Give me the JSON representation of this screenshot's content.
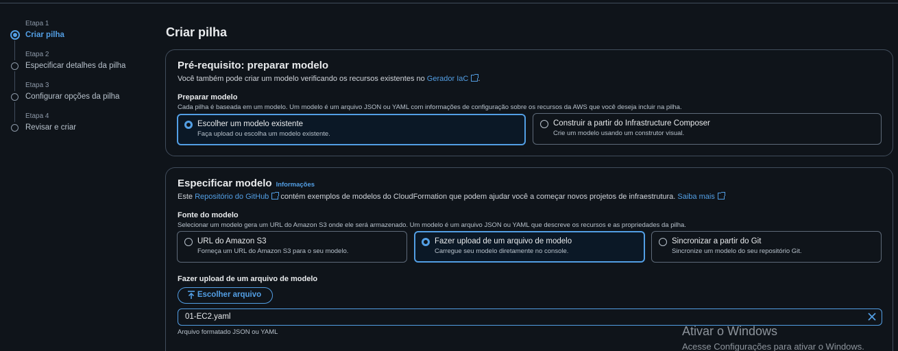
{
  "steps": [
    {
      "number": "Etapa 1",
      "name": "Criar pilha"
    },
    {
      "number": "Etapa 2",
      "name": "Especificar detalhes da pilha"
    },
    {
      "number": "Etapa 3",
      "name": "Configurar opções da pilha"
    },
    {
      "number": "Etapa 4",
      "name": "Revisar e criar"
    }
  ],
  "page_title": "Criar pilha",
  "prereq": {
    "title": "Pré-requisito: preparar modelo",
    "desc_prefix": "Você também pode criar um modelo verificando os recursos existentes no ",
    "desc_link": "Gerador IaC",
    "desc_suffix": ".",
    "field_label": "Preparar modelo",
    "field_help": "Cada pilha é baseada em um modelo. Um modelo é um arquivo JSON ou YAML com informações de configuração sobre os recursos da AWS que você deseja incluir na pilha.",
    "options": [
      {
        "title": "Escolher um modelo existente",
        "sub": "Faça upload ou escolha um modelo existente.",
        "selected": true
      },
      {
        "title": "Construir a partir do Infrastructure Composer",
        "sub": "Crie um modelo usando um construtor visual.",
        "selected": false
      }
    ]
  },
  "spec": {
    "title": "Especificar modelo",
    "info_link": "Informações",
    "desc_prefix": "Este ",
    "desc_link1": "Repositório do GitHub",
    "desc_middle": " contém exemplos de modelos do CloudFormation que podem ajudar você a começar novos projetos de infraestrutura. ",
    "desc_link2": "Saiba mais",
    "field_label": "Fonte do modelo",
    "field_help": "Selecionar um modelo gera um URL do Amazon S3 onde ele será armazenado. Um modelo é um arquivo JSON ou YAML que descreve os recursos e as propriedades da pilha.",
    "options": [
      {
        "title": "URL do Amazon S3",
        "sub": "Forneça um URL do Amazon S3 para o seu modelo.",
        "selected": false
      },
      {
        "title": "Fazer upload de um arquivo de modelo",
        "sub": "Carregue seu modelo diretamente no console.",
        "selected": true
      },
      {
        "title": "Sincronizar a partir do Git",
        "sub": "Sincronize um modelo do seu repositório Git.",
        "selected": false
      }
    ],
    "upload_label": "Fazer upload de um arquivo de modelo",
    "upload_button": "Escolher arquivo",
    "file_name": "01-EC2.yaml",
    "file_hint": "Arquivo formatado JSON ou YAML"
  },
  "watermark": {
    "line1": "Ativar o Windows",
    "line2": "Acesse Configurações para ativar o Windows."
  },
  "colors": {
    "accent": "#539fe5",
    "background": "#0f141a",
    "border": "#414d5c"
  }
}
